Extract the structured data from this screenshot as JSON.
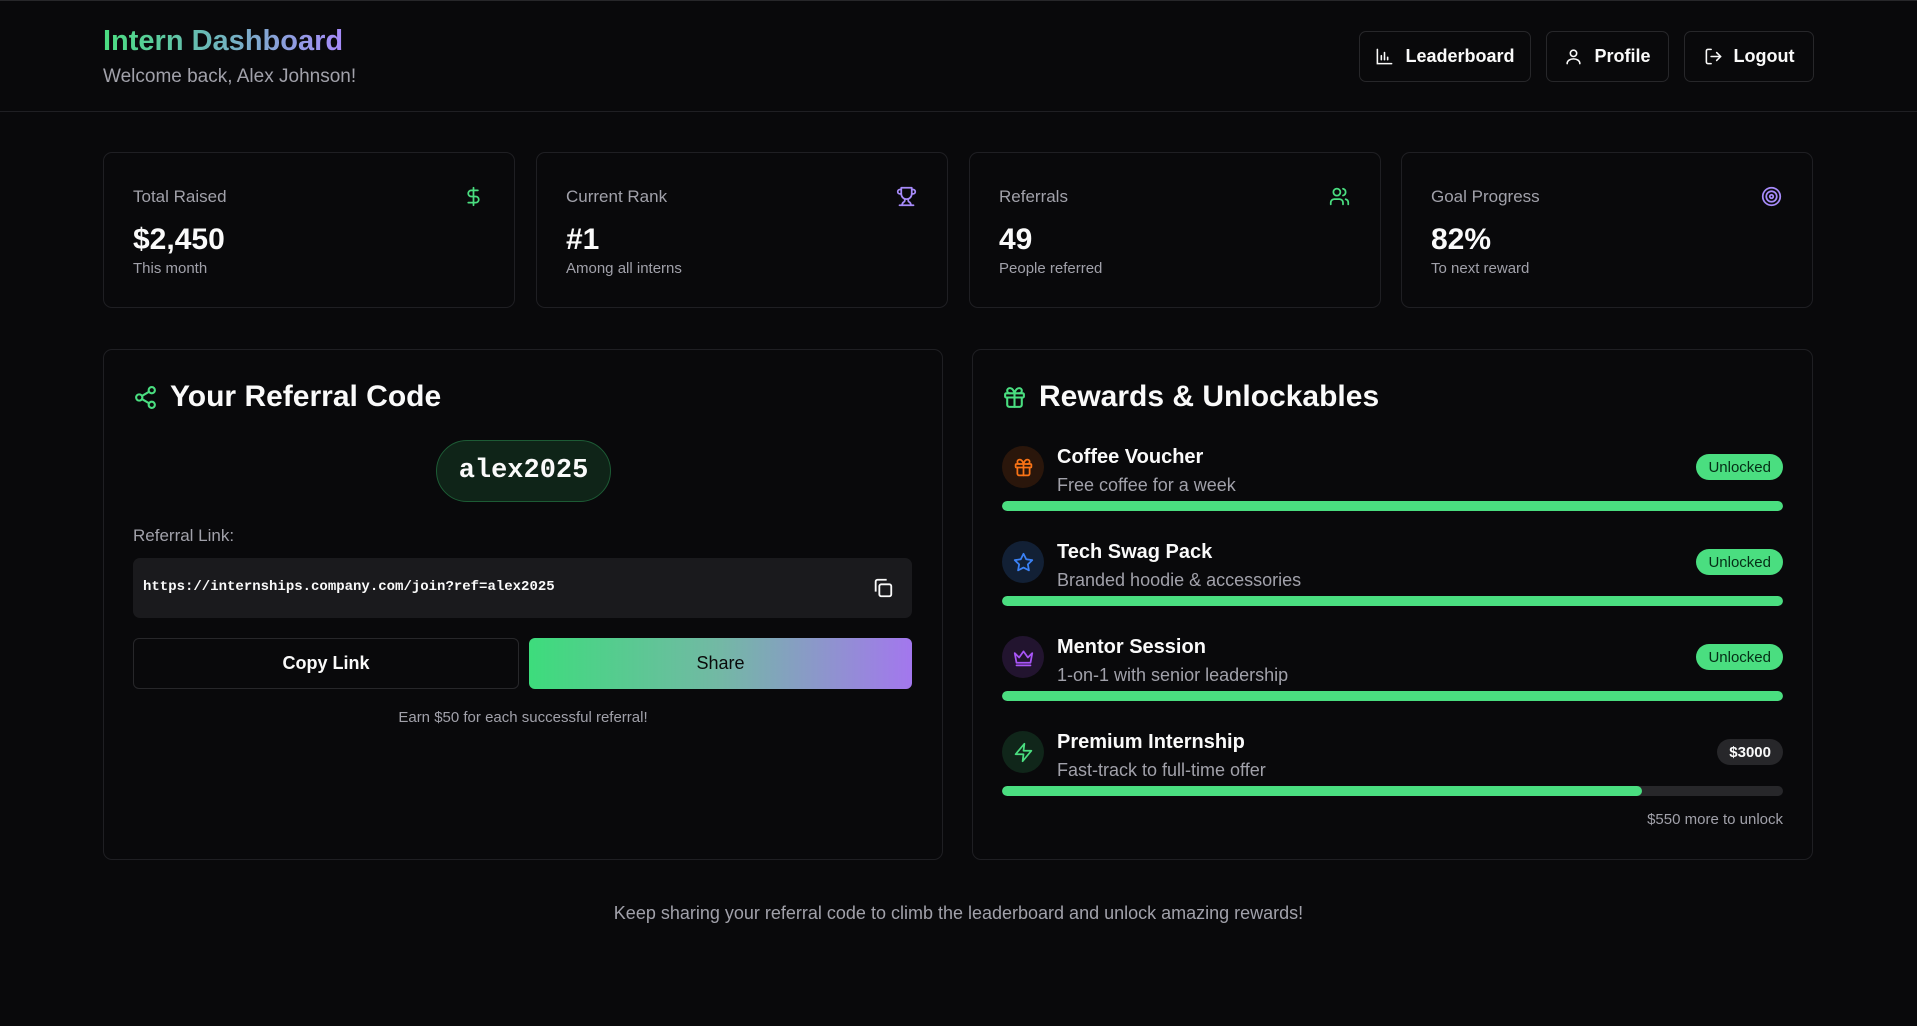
{
  "header": {
    "title": "Intern Dashboard",
    "welcome": "Welcome back, Alex Johnson!",
    "buttons": {
      "leaderboard": "Leaderboard",
      "profile": "Profile",
      "logout": "Logout"
    }
  },
  "stats": [
    {
      "label": "Total Raised",
      "value": "$2,450",
      "note": "This month",
      "icon": "dollar-icon",
      "color": "#4ade80"
    },
    {
      "label": "Current Rank",
      "value": "#1",
      "note": "Among all interns",
      "icon": "trophy-icon",
      "color": "#a78bfa"
    },
    {
      "label": "Referrals",
      "value": "49",
      "note": "People referred",
      "icon": "users-icon",
      "color": "#4ade80"
    },
    {
      "label": "Goal Progress",
      "value": "82%",
      "note": "To next reward",
      "icon": "target-icon",
      "color": "#a78bfa"
    }
  ],
  "referral": {
    "title": "Your Referral Code",
    "code": "alex2025",
    "link_label": "Referral Link:",
    "link": "https://internships.company.com/join?ref=alex2025",
    "copy_label": "Copy Link",
    "share_label": "Share",
    "note": "Earn $50 for each successful referral!"
  },
  "rewards": {
    "title": "Rewards & Unlockables",
    "items": [
      {
        "title": "Coffee Voucher",
        "desc": "Free coffee for a week",
        "badge": "Unlocked",
        "progress": 1.0,
        "icon": "gift-icon",
        "color": "#f97316"
      },
      {
        "title": "Tech Swag Pack",
        "desc": "Branded hoodie & accessories",
        "badge": "Unlocked",
        "progress": 1.0,
        "icon": "star-icon",
        "color": "#3b82f6"
      },
      {
        "title": "Mentor Session",
        "desc": "1-on-1 with senior leadership",
        "badge": "Unlocked",
        "progress": 1.0,
        "icon": "crown-icon",
        "color": "#a855f7"
      },
      {
        "title": "Premium Internship",
        "desc": "Fast-track to full-time offer",
        "badge": "$3000",
        "progress": 0.82,
        "icon": "zap-icon",
        "color": "#4ade80"
      }
    ],
    "remaining_note": "$550 more to unlock"
  },
  "footer": "Keep sharing your referral code to climb the leaderboard and unlock amazing rewards!",
  "colors": {
    "accent_green": "#4ade80",
    "accent_purple": "#a78bfa",
    "background": "#09090b"
  }
}
